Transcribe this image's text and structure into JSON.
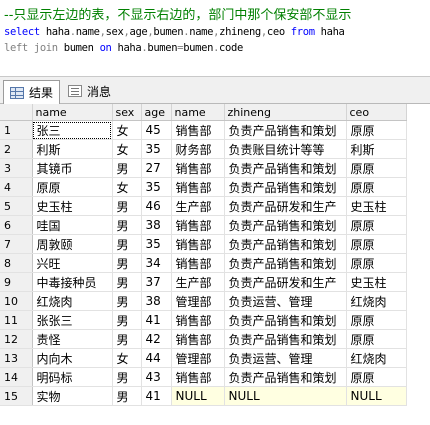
{
  "editor": {
    "comment": "--只显示左边的表，不显示右边的，部门中那个保安部不显示",
    "line2": [
      {
        "t": "select",
        "c": "kw"
      },
      {
        "t": " haha",
        "c": "id"
      },
      {
        "t": ".",
        "c": "op"
      },
      {
        "t": "name",
        "c": "id"
      },
      {
        "t": ",",
        "c": "op"
      },
      {
        "t": "sex",
        "c": "id"
      },
      {
        "t": ",",
        "c": "op"
      },
      {
        "t": "age",
        "c": "id"
      },
      {
        "t": ",",
        "c": "op"
      },
      {
        "t": "bumen",
        "c": "id"
      },
      {
        "t": ".",
        "c": "op"
      },
      {
        "t": "name",
        "c": "id"
      },
      {
        "t": ",",
        "c": "op"
      },
      {
        "t": "zhineng",
        "c": "id"
      },
      {
        "t": ",",
        "c": "op"
      },
      {
        "t": "ceo ",
        "c": "id"
      },
      {
        "t": "from",
        "c": "kw"
      },
      {
        "t": " haha",
        "c": "id"
      }
    ],
    "line3": [
      {
        "t": "left join",
        "c": "op"
      },
      {
        "t": " bumen ",
        "c": "id"
      },
      {
        "t": "on",
        "c": "kw"
      },
      {
        "t": " haha",
        "c": "id"
      },
      {
        "t": ".",
        "c": "op"
      },
      {
        "t": "bumen",
        "c": "id"
      },
      {
        "t": "=",
        "c": "op"
      },
      {
        "t": "bumen",
        "c": "id"
      },
      {
        "t": ".",
        "c": "op"
      },
      {
        "t": "code",
        "c": "id"
      }
    ]
  },
  "tabs": [
    {
      "label": "结果",
      "icon": "grid-icon",
      "active": true
    },
    {
      "label": "消息",
      "icon": "message-icon",
      "active": false
    }
  ],
  "results": {
    "columns": [
      "name",
      "sex",
      "age",
      "name",
      "zhineng",
      "ceo"
    ],
    "rows": [
      [
        "1",
        "张三",
        "女",
        "45",
        "销售部",
        "负责产品销售和策划",
        "原原"
      ],
      [
        "2",
        "利斯",
        "女",
        "35",
        "财务部",
        "负责账目统计等等",
        "利斯"
      ],
      [
        "3",
        "其镜币",
        "男",
        "27",
        "销售部",
        "负责产品销售和策划",
        "原原"
      ],
      [
        "4",
        "原原",
        "女",
        "35",
        "销售部",
        "负责产品销售和策划",
        "原原"
      ],
      [
        "5",
        "史玉柱",
        "男",
        "46",
        "生产部",
        "负责产品研发和生产",
        "史玉柱"
      ],
      [
        "6",
        "哇国",
        "男",
        "38",
        "销售部",
        "负责产品销售和策划",
        "原原"
      ],
      [
        "7",
        "周敦颐",
        "男",
        "35",
        "销售部",
        "负责产品销售和策划",
        "原原"
      ],
      [
        "8",
        "兴旺",
        "男",
        "34",
        "销售部",
        "负责产品销售和策划",
        "原原"
      ],
      [
        "9",
        "中毒接种员",
        "男",
        "37",
        "生产部",
        "负责产品研发和生产",
        "史玉柱"
      ],
      [
        "10",
        "红烧肉",
        "男",
        "38",
        "管理部",
        "负责运营、管理",
        "红烧肉"
      ],
      [
        "11",
        "张张三",
        "男",
        "41",
        "销售部",
        "负责产品销售和策划",
        "原原"
      ],
      [
        "12",
        "责怪",
        "男",
        "42",
        "销售部",
        "负责产品销售和策划",
        "原原"
      ],
      [
        "13",
        "内向木",
        "女",
        "44",
        "管理部",
        "负责运营、管理",
        "红烧肉"
      ],
      [
        "14",
        "明码标",
        "男",
        "43",
        "销售部",
        "负责产品销售和策划",
        "原原"
      ],
      [
        "15",
        "实物",
        "男",
        "41",
        "NULL",
        "NULL",
        "NULL"
      ]
    ]
  }
}
